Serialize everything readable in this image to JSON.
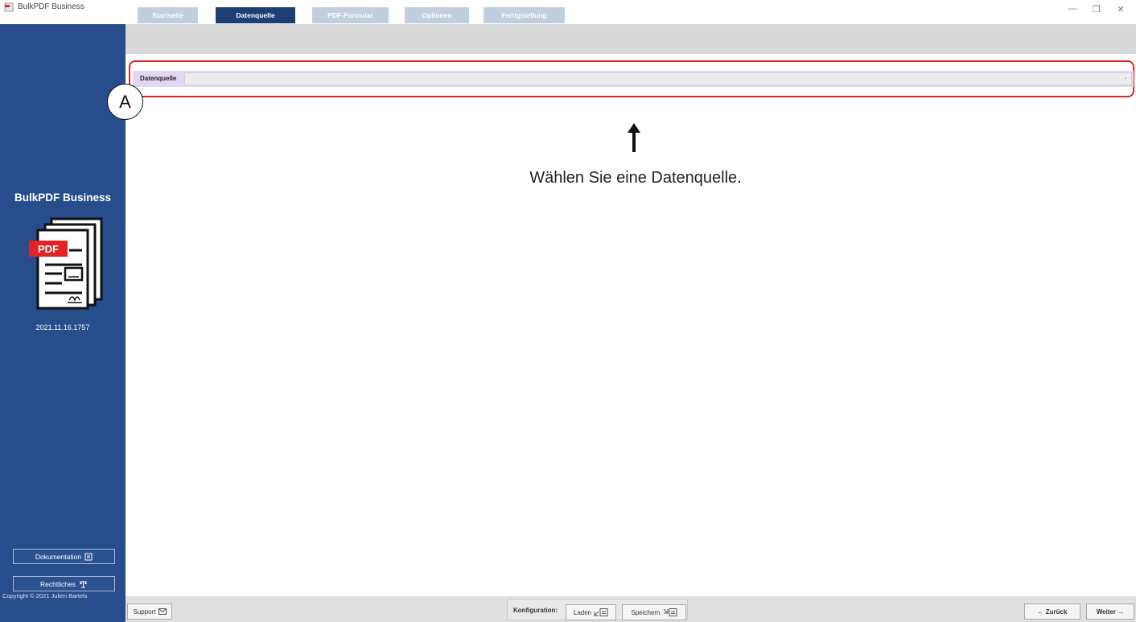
{
  "window": {
    "title": "BulkPDF Business",
    "minimize_label": "—",
    "maximize_label": "❐",
    "close_label": "✕"
  },
  "steps": [
    {
      "label": "Startseite",
      "active": false
    },
    {
      "label": "Datenquelle",
      "active": true
    },
    {
      "label": "PDF-Formular",
      "active": false
    },
    {
      "label": "Optionen",
      "active": false
    },
    {
      "label": "Fertigstellung",
      "active": false
    }
  ],
  "sidebar": {
    "brand": "BulkPDF Business",
    "logo_badge": "PDF",
    "version": "2021.11.16.1757",
    "documentation_label": "Dokumentation",
    "legal_label": "Rechtliches",
    "copyright": "Copyright © 2021 Julien Bartels"
  },
  "datasource": {
    "label": "Datenquelle",
    "selected_value": ""
  },
  "annotation": {
    "badge": "A",
    "hint": "Wählen Sie eine Datenquelle."
  },
  "bottombar": {
    "support_label": "Support",
    "config_label": "Konfiguration:",
    "load_label": "Laden",
    "save_label": "Speichern",
    "back_label": "← Zurück",
    "next_label": "Weiter →"
  },
  "colors": {
    "sidebar": "#274d8c",
    "active_step": "#1d3f73",
    "inactive_step": "#c1cedf",
    "highlight": "#d9262b",
    "datasource_row": "#e3d6f3"
  }
}
